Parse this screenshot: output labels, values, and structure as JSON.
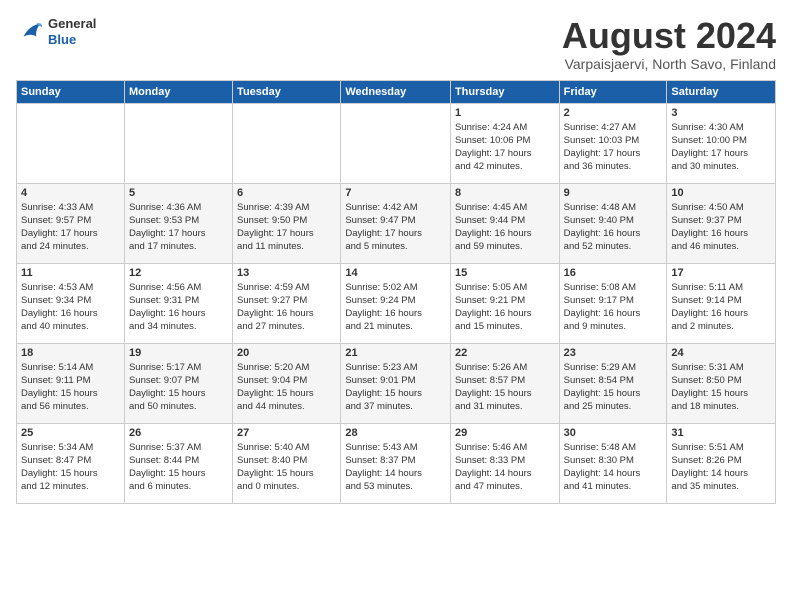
{
  "header": {
    "logo": {
      "general": "General",
      "blue": "Blue"
    },
    "title": "August 2024",
    "location": "Varpaisjaervi, North Savo, Finland"
  },
  "calendar": {
    "days_of_week": [
      "Sunday",
      "Monday",
      "Tuesday",
      "Wednesday",
      "Thursday",
      "Friday",
      "Saturday"
    ],
    "weeks": [
      [
        {
          "day": "",
          "info": ""
        },
        {
          "day": "",
          "info": ""
        },
        {
          "day": "",
          "info": ""
        },
        {
          "day": "",
          "info": ""
        },
        {
          "day": "1",
          "info": "Sunrise: 4:24 AM\nSunset: 10:06 PM\nDaylight: 17 hours\nand 42 minutes."
        },
        {
          "day": "2",
          "info": "Sunrise: 4:27 AM\nSunset: 10:03 PM\nDaylight: 17 hours\nand 36 minutes."
        },
        {
          "day": "3",
          "info": "Sunrise: 4:30 AM\nSunset: 10:00 PM\nDaylight: 17 hours\nand 30 minutes."
        }
      ],
      [
        {
          "day": "4",
          "info": "Sunrise: 4:33 AM\nSunset: 9:57 PM\nDaylight: 17 hours\nand 24 minutes."
        },
        {
          "day": "5",
          "info": "Sunrise: 4:36 AM\nSunset: 9:53 PM\nDaylight: 17 hours\nand 17 minutes."
        },
        {
          "day": "6",
          "info": "Sunrise: 4:39 AM\nSunset: 9:50 PM\nDaylight: 17 hours\nand 11 minutes."
        },
        {
          "day": "7",
          "info": "Sunrise: 4:42 AM\nSunset: 9:47 PM\nDaylight: 17 hours\nand 5 minutes."
        },
        {
          "day": "8",
          "info": "Sunrise: 4:45 AM\nSunset: 9:44 PM\nDaylight: 16 hours\nand 59 minutes."
        },
        {
          "day": "9",
          "info": "Sunrise: 4:48 AM\nSunset: 9:40 PM\nDaylight: 16 hours\nand 52 minutes."
        },
        {
          "day": "10",
          "info": "Sunrise: 4:50 AM\nSunset: 9:37 PM\nDaylight: 16 hours\nand 46 minutes."
        }
      ],
      [
        {
          "day": "11",
          "info": "Sunrise: 4:53 AM\nSunset: 9:34 PM\nDaylight: 16 hours\nand 40 minutes."
        },
        {
          "day": "12",
          "info": "Sunrise: 4:56 AM\nSunset: 9:31 PM\nDaylight: 16 hours\nand 34 minutes."
        },
        {
          "day": "13",
          "info": "Sunrise: 4:59 AM\nSunset: 9:27 PM\nDaylight: 16 hours\nand 27 minutes."
        },
        {
          "day": "14",
          "info": "Sunrise: 5:02 AM\nSunset: 9:24 PM\nDaylight: 16 hours\nand 21 minutes."
        },
        {
          "day": "15",
          "info": "Sunrise: 5:05 AM\nSunset: 9:21 PM\nDaylight: 16 hours\nand 15 minutes."
        },
        {
          "day": "16",
          "info": "Sunrise: 5:08 AM\nSunset: 9:17 PM\nDaylight: 16 hours\nand 9 minutes."
        },
        {
          "day": "17",
          "info": "Sunrise: 5:11 AM\nSunset: 9:14 PM\nDaylight: 16 hours\nand 2 minutes."
        }
      ],
      [
        {
          "day": "18",
          "info": "Sunrise: 5:14 AM\nSunset: 9:11 PM\nDaylight: 15 hours\nand 56 minutes."
        },
        {
          "day": "19",
          "info": "Sunrise: 5:17 AM\nSunset: 9:07 PM\nDaylight: 15 hours\nand 50 minutes."
        },
        {
          "day": "20",
          "info": "Sunrise: 5:20 AM\nSunset: 9:04 PM\nDaylight: 15 hours\nand 44 minutes."
        },
        {
          "day": "21",
          "info": "Sunrise: 5:23 AM\nSunset: 9:01 PM\nDaylight: 15 hours\nand 37 minutes."
        },
        {
          "day": "22",
          "info": "Sunrise: 5:26 AM\nSunset: 8:57 PM\nDaylight: 15 hours\nand 31 minutes."
        },
        {
          "day": "23",
          "info": "Sunrise: 5:29 AM\nSunset: 8:54 PM\nDaylight: 15 hours\nand 25 minutes."
        },
        {
          "day": "24",
          "info": "Sunrise: 5:31 AM\nSunset: 8:50 PM\nDaylight: 15 hours\nand 18 minutes."
        }
      ],
      [
        {
          "day": "25",
          "info": "Sunrise: 5:34 AM\nSunset: 8:47 PM\nDaylight: 15 hours\nand 12 minutes."
        },
        {
          "day": "26",
          "info": "Sunrise: 5:37 AM\nSunset: 8:44 PM\nDaylight: 15 hours\nand 6 minutes."
        },
        {
          "day": "27",
          "info": "Sunrise: 5:40 AM\nSunset: 8:40 PM\nDaylight: 15 hours\nand 0 minutes."
        },
        {
          "day": "28",
          "info": "Sunrise: 5:43 AM\nSunset: 8:37 PM\nDaylight: 14 hours\nand 53 minutes."
        },
        {
          "day": "29",
          "info": "Sunrise: 5:46 AM\nSunset: 8:33 PM\nDaylight: 14 hours\nand 47 minutes."
        },
        {
          "day": "30",
          "info": "Sunrise: 5:48 AM\nSunset: 8:30 PM\nDaylight: 14 hours\nand 41 minutes."
        },
        {
          "day": "31",
          "info": "Sunrise: 5:51 AM\nSunset: 8:26 PM\nDaylight: 14 hours\nand 35 minutes."
        }
      ]
    ]
  }
}
